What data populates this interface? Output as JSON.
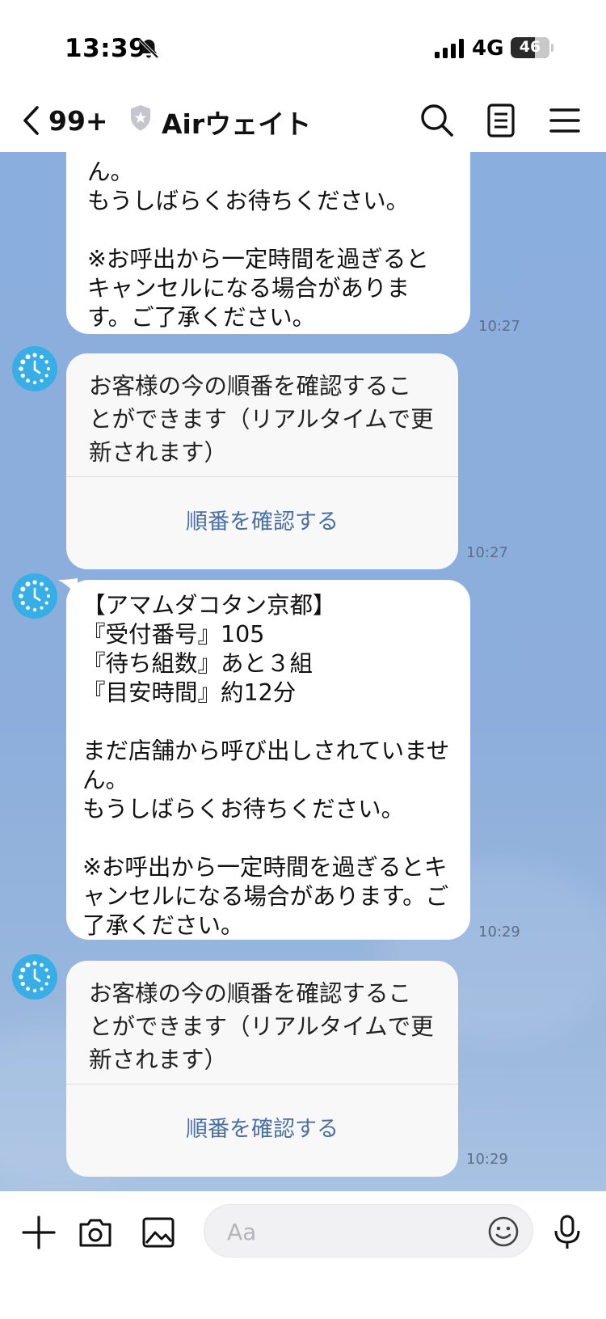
{
  "status_bar": {
    "time": "13:39",
    "network": "4G",
    "battery": "46"
  },
  "header": {
    "back_count": "99+",
    "title": "Airウェイト"
  },
  "messages": [
    {
      "text": "ん。\nもうしばらくお待ちください。\n\n※お呼出から一定時間を過ぎるとキャンセルになる場合があります。ご了承ください。",
      "time": "10:27"
    },
    {
      "card_text": "お客様の今の順番を確認することができます（リアルタイムで更新されます）",
      "button_label": "順番を確認する",
      "time": "10:27"
    },
    {
      "text": "【アマムダコタン京都】\n『受付番号』105\n『待ち組数』あと３組\n『目安時間』約12分\n\nまだ店舗から呼び出しされていません。\nもうしばらくお待ちください。\n\n※お呼出から一定時間を過ぎるとキャンセルになる場合があります。ご了承ください。",
      "time": "10:29"
    },
    {
      "card_text": "お客様の今の順番を確認することができます（リアルタイムで更新されます）",
      "button_label": "順番を確認する",
      "time": "10:29"
    }
  ],
  "input": {
    "placeholder": "Aa"
  },
  "colors": {
    "chat_background": "#8aaede",
    "avatar": "#37aee6",
    "link_button": "#4a6fa3"
  }
}
